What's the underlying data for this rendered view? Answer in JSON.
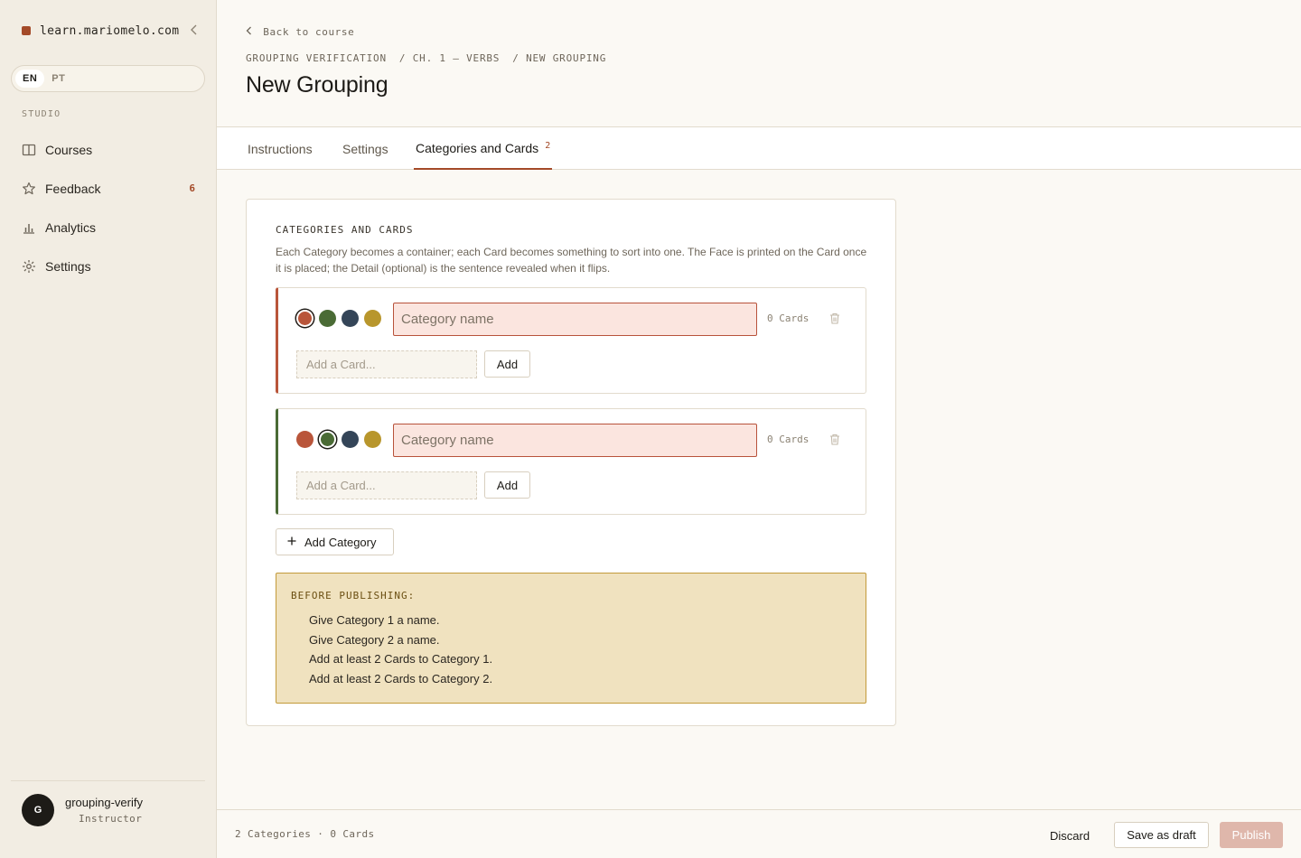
{
  "sidebar": {
    "brand": "learn.mariomelo.com",
    "collapse_icon": "chevron-left-icon",
    "languages": [
      "EN",
      "PT"
    ],
    "active_language": "EN",
    "section_label": "STUDIO",
    "items": [
      {
        "label": "Courses",
        "icon": "book-icon"
      },
      {
        "label": "Feedback",
        "icon": "star-icon",
        "badge": "6"
      },
      {
        "label": "Analytics",
        "icon": "bar-chart-icon"
      },
      {
        "label": "Settings",
        "icon": "gear-icon"
      }
    ],
    "user": {
      "initial": "G",
      "name": "grouping-verify",
      "role": "Instructor"
    }
  },
  "header": {
    "back": "Back to course",
    "breadcrumbs": [
      "GROUPING VERIFICATION",
      "/ CH. 1 — VERBS",
      "/ NEW GROUPING"
    ],
    "title": "New Grouping"
  },
  "tabs": [
    {
      "label": "Instructions"
    },
    {
      "label": "Settings"
    },
    {
      "label": "Categories and Cards",
      "count": "2",
      "active": true
    }
  ],
  "panel": {
    "title": "CATEGORIES AND CARDS",
    "description": "Each Category becomes a container; each Card becomes something to sort into one. The Face is printed on the Card once it is placed; the Detail (optional) is the sentence revealed when it flips.",
    "swatch_colors": [
      "#b9553a",
      "#4a6b35",
      "#344558",
      "#b8962c"
    ],
    "categories": [
      {
        "name_placeholder": "Category name",
        "name_value": "",
        "cards_label": "0 Cards",
        "selected_color": "#b9553a",
        "add_card_placeholder": "Add a Card...",
        "add_label": "Add"
      },
      {
        "name_placeholder": "Category name",
        "name_value": "",
        "cards_label": "0 Cards",
        "selected_color": "#4a6b35",
        "add_card_placeholder": "Add a Card...",
        "add_label": "Add"
      }
    ],
    "add_category": "Add Category",
    "warning": {
      "title": "BEFORE PUBLISHING:",
      "items": [
        "Give Category 1 a name.",
        "Give Category 2 a name.",
        "Add at least 2 Cards to Category 1.",
        "Add at least 2 Cards to Category 2."
      ]
    }
  },
  "footer": {
    "summary": "2 Categories · 0 Cards",
    "discard": "Discard",
    "save_draft": "Save as draft",
    "publish": "Publish"
  }
}
